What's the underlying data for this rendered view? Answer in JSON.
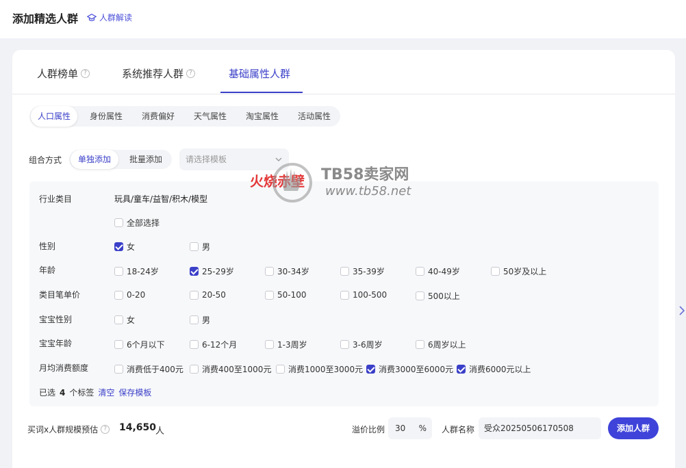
{
  "header": {
    "title": "添加精选人群",
    "help_link": "人群解读"
  },
  "tabs": [
    {
      "label": "人群榜单",
      "help": "?"
    },
    {
      "label": "系统推荐人群",
      "help": "?"
    },
    {
      "label": "基础属性人群"
    }
  ],
  "subtabs": [
    "人口属性",
    "身份属性",
    "消费偏好",
    "天气属性",
    "淘宝属性",
    "活动属性"
  ],
  "combo": {
    "label": "组合方式",
    "options": [
      "单独添加",
      "批量添加"
    ],
    "template_placeholder": "请选择模板"
  },
  "panel": {
    "industry": {
      "label": "行业类目",
      "value": "玩具/童车/益智/积木/模型"
    },
    "select_all": "全部选择",
    "gender": {
      "label": "性别",
      "options": [
        "女",
        "男"
      ],
      "checked": [
        true,
        false
      ]
    },
    "age": {
      "label": "年龄",
      "options": [
        "18-24岁",
        "25-29岁",
        "30-34岁",
        "35-39岁",
        "40-49岁",
        "50岁及以上"
      ],
      "checked": [
        false,
        true,
        false,
        false,
        false,
        false
      ]
    },
    "unit_price": {
      "label": "类目笔单价",
      "options": [
        "0-20",
        "20-50",
        "50-100",
        "100-500",
        "500以上"
      ],
      "checked": [
        false,
        false,
        false,
        false,
        false
      ]
    },
    "baby_gender": {
      "label": "宝宝性别",
      "options": [
        "女",
        "男"
      ],
      "checked": [
        false,
        false
      ]
    },
    "baby_age": {
      "label": "宝宝年龄",
      "options": [
        "6个月以下",
        "6-12个月",
        "1-3周岁",
        "3-6周岁",
        "6周岁以上"
      ],
      "checked": [
        false,
        false,
        false,
        false,
        false
      ]
    },
    "monthly_spend": {
      "label": "月均消费额度",
      "options": [
        "消费低于400元",
        "消费400至1000元",
        "消费1000至3000元",
        "消费3000至6000元",
        "消费6000元以上"
      ],
      "checked": [
        false,
        false,
        false,
        true,
        true
      ]
    },
    "selected": {
      "prefix": "已选",
      "count": "4",
      "suffix": "个标签",
      "clear": "清空",
      "save_template": "保存模板"
    }
  },
  "watermark": {
    "red_text": "火烧赤壁",
    "title": "TB58卖家网",
    "url": "www.tb58.net"
  },
  "bottom": {
    "estimate_label": "买词x人群规模预估",
    "estimate_help": "?",
    "estimate_value": "14,650",
    "estimate_unit": "人",
    "premium_label": "溢价比例",
    "premium_value": "30",
    "premium_unit": "%",
    "name_label": "人群名称",
    "name_value": "受众20250506170508",
    "add_button": "添加人群"
  },
  "colors": {
    "accent": "#3b40c8",
    "button": "#3f43d9",
    "watermark_red": "#e43838"
  }
}
